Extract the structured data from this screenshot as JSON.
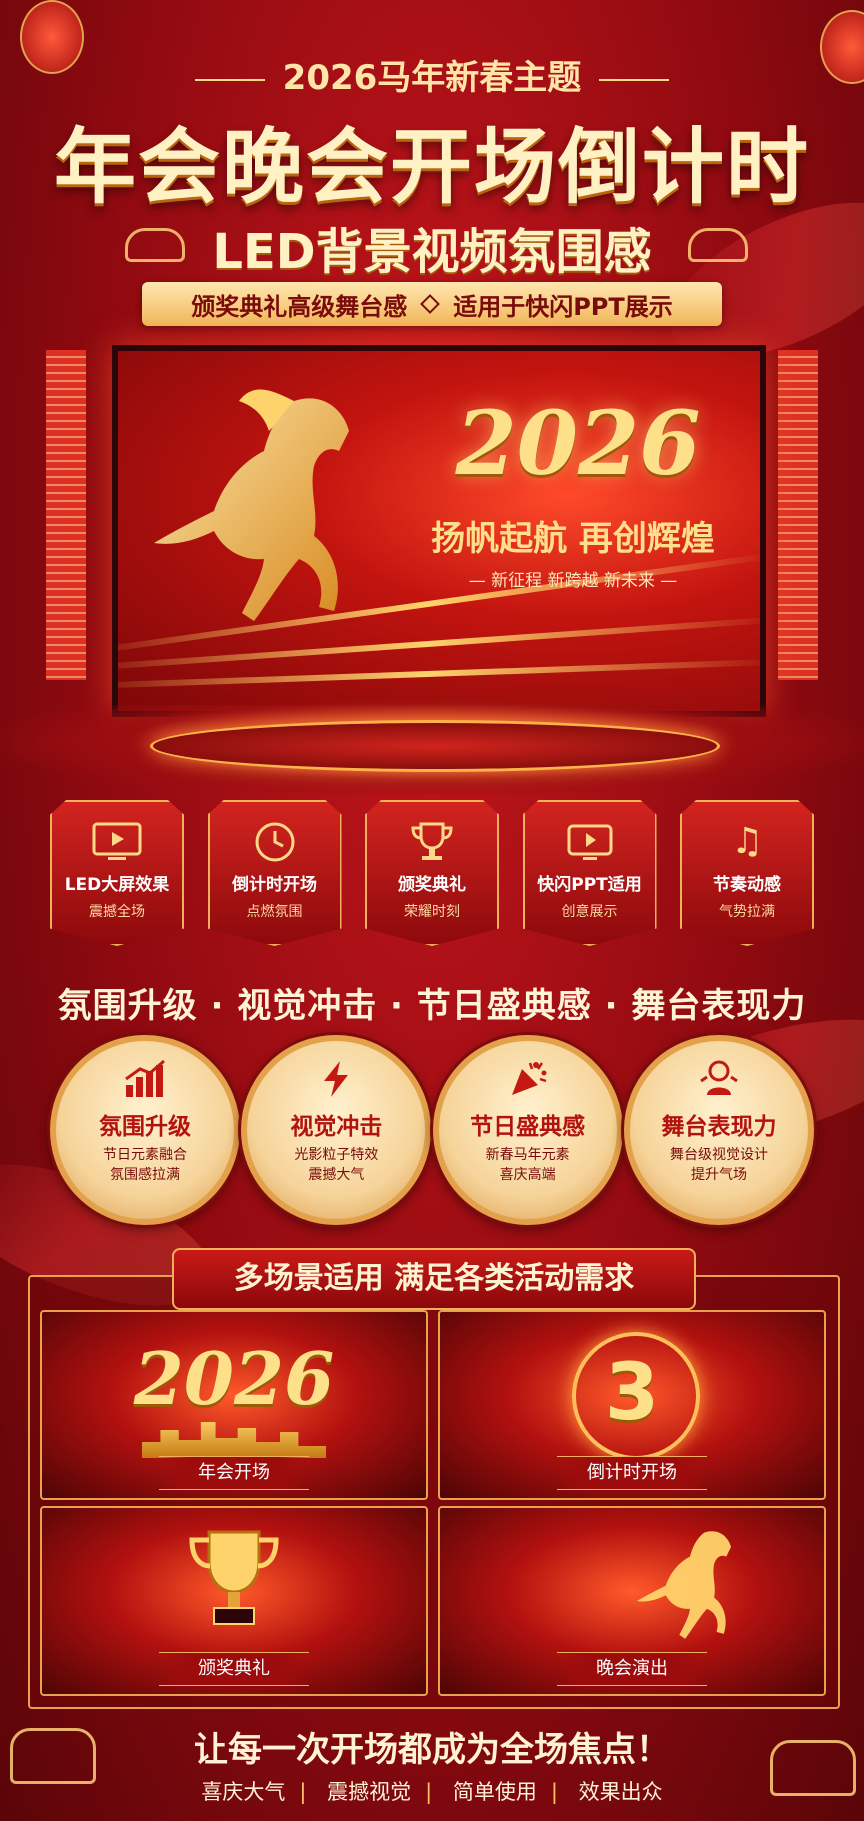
{
  "header": {
    "kicker": "2026马年新春主题",
    "title": "年会晚会开场倒计时",
    "subtitle": "LED背景视频氛围感",
    "tags": [
      "颁奖典礼高级舞台感",
      "适用于快闪PPT展示"
    ]
  },
  "screen": {
    "year": "2026",
    "slogan": "扬帆起航 再创辉煌",
    "sub": "— 新征程  新跨越  新未来 —"
  },
  "features": [
    {
      "icon": "monitor-play-icon",
      "title": "LED大屏效果",
      "sub": "震撼全场"
    },
    {
      "icon": "clock-icon",
      "title": "倒计时开场",
      "sub": "点燃氛围"
    },
    {
      "icon": "trophy-icon",
      "title": "颁奖典礼",
      "sub": "荣耀时刻"
    },
    {
      "icon": "play-screen-icon",
      "title": "快闪PPT适用",
      "sub": "创意展示"
    },
    {
      "icon": "music-note-icon",
      "title": "节奏动感",
      "sub": "气势拉满"
    }
  ],
  "highlight": "氛围升级 · 视觉冲击 · 节日盛典感 · 舞台表现力",
  "medals": [
    {
      "icon": "bar-chart-icon",
      "title": "氛围升级",
      "line1": "节日元素融合",
      "line2": "氛围感拉满"
    },
    {
      "icon": "lightning-icon",
      "title": "视觉冲击",
      "line1": "光影粒子特效",
      "line2": "震撼大气"
    },
    {
      "icon": "party-popper-icon",
      "title": "节日盛典感",
      "line1": "新春马年元素",
      "line2": "喜庆高端"
    },
    {
      "icon": "spotlight-icon",
      "title": "舞台表现力",
      "line1": "舞台级视觉设计",
      "line2": "提升气场"
    }
  ],
  "scenes": {
    "header": "多场景适用  满足各类活动需求",
    "items": [
      {
        "label": "年会开场",
        "big": "2026"
      },
      {
        "label": "倒计时开场",
        "big": "3"
      },
      {
        "label": "颁奖典礼",
        "big": ""
      },
      {
        "label": "晚会演出",
        "big": ""
      }
    ]
  },
  "closing": {
    "line": "让每一次开场都成为全场焦点！",
    "tags": [
      "喜庆大气",
      "震撼视觉",
      "简单使用",
      "效果出众"
    ]
  },
  "colors": {
    "red": "#c4161c",
    "gold": "#ffd98a",
    "dark": "#5a0508"
  }
}
